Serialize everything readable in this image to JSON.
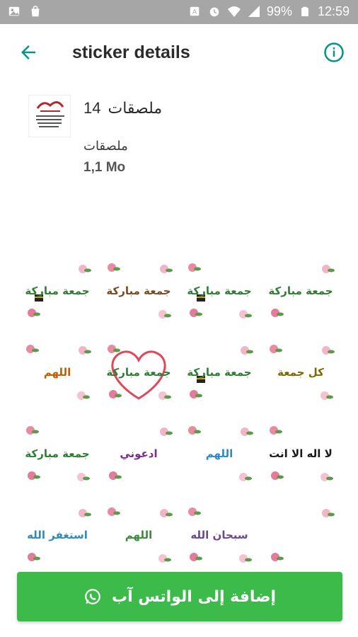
{
  "status_bar": {
    "battery": "99%",
    "time": "12:59"
  },
  "toolbar": {
    "title": "sticker details"
  },
  "pack": {
    "count": "14",
    "name": "ملصقات",
    "publisher": "ملصقات",
    "size": "1,1 Mo"
  },
  "stickers": [
    {
      "caption": "جمعة مباركة",
      "color": "#2e7d32"
    },
    {
      "caption": "جمعة مباركة",
      "color": "#7a4a1e"
    },
    {
      "caption": "جمعة مباركة",
      "color": "#2e7d32"
    },
    {
      "caption": "جمعة مباركة",
      "color": "#2e7d32"
    },
    {
      "caption": "اللهم",
      "color": "#c75a00"
    },
    {
      "caption": "جمعة مباركة",
      "color": "#2e7d32"
    },
    {
      "caption": "جمعة مباركة",
      "color": "#2e7d32"
    },
    {
      "caption": "كل جمعة",
      "color": "#7a6a00"
    },
    {
      "caption": "جمعة مباركة",
      "color": "#2e7d32"
    },
    {
      "caption": "ادعوني",
      "color": "#7b2d8b"
    },
    {
      "caption": "اللهم",
      "color": "#2e8bc0"
    },
    {
      "caption": "لا اله الا انت",
      "color": "#1a1a1a"
    },
    {
      "caption": "استغفر الله",
      "color": "#2e8bc0"
    },
    {
      "caption": "اللهم",
      "color": "#3d8a3d"
    },
    {
      "caption": "سبحان الله",
      "color": "#6b4b8b"
    },
    {
      "caption": "",
      "color": "#6a4bb8"
    }
  ],
  "add_button": {
    "label": "إضافة إلى الواتس آب"
  },
  "colors": {
    "accent": "#009688",
    "button": "#3dbb4a",
    "statusbar": "#a6a6a6"
  }
}
